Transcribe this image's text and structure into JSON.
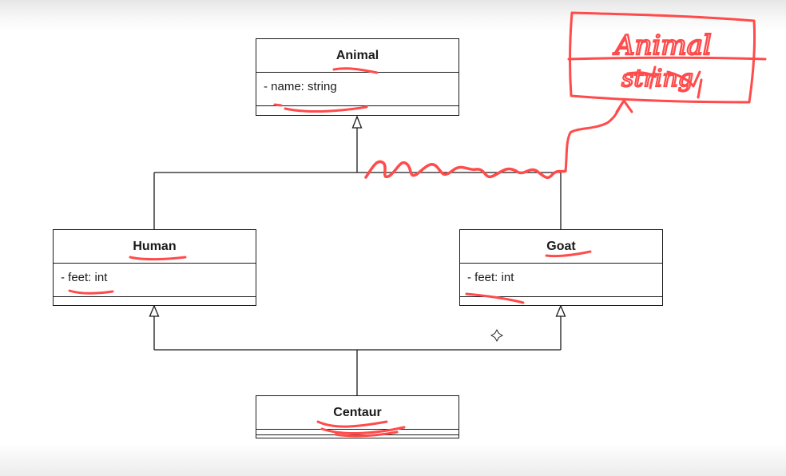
{
  "diagram": {
    "classes": {
      "animal": {
        "name": "Animal",
        "attributes": [
          "- name: string"
        ]
      },
      "human": {
        "name": "Human",
        "attributes": [
          "- feet: int"
        ]
      },
      "goat": {
        "name": "Goat",
        "attributes": [
          "- feet: int"
        ]
      },
      "centaur": {
        "name": "Centaur",
        "attributes": []
      }
    },
    "relationships": [
      {
        "type": "inheritance",
        "child": "Human",
        "parent": "Animal"
      },
      {
        "type": "inheritance",
        "child": "Goat",
        "parent": "Animal"
      },
      {
        "type": "inheritance",
        "child": "Centaur",
        "parent": "Human"
      },
      {
        "type": "inheritance",
        "child": "Centaur",
        "parent": "Goat"
      }
    ]
  },
  "annotations": {
    "ink_color": "#ff4b4b",
    "handwritten_box": [
      "Animal",
      "string"
    ],
    "cursor_icon": "crosshair-cursor-icon"
  }
}
